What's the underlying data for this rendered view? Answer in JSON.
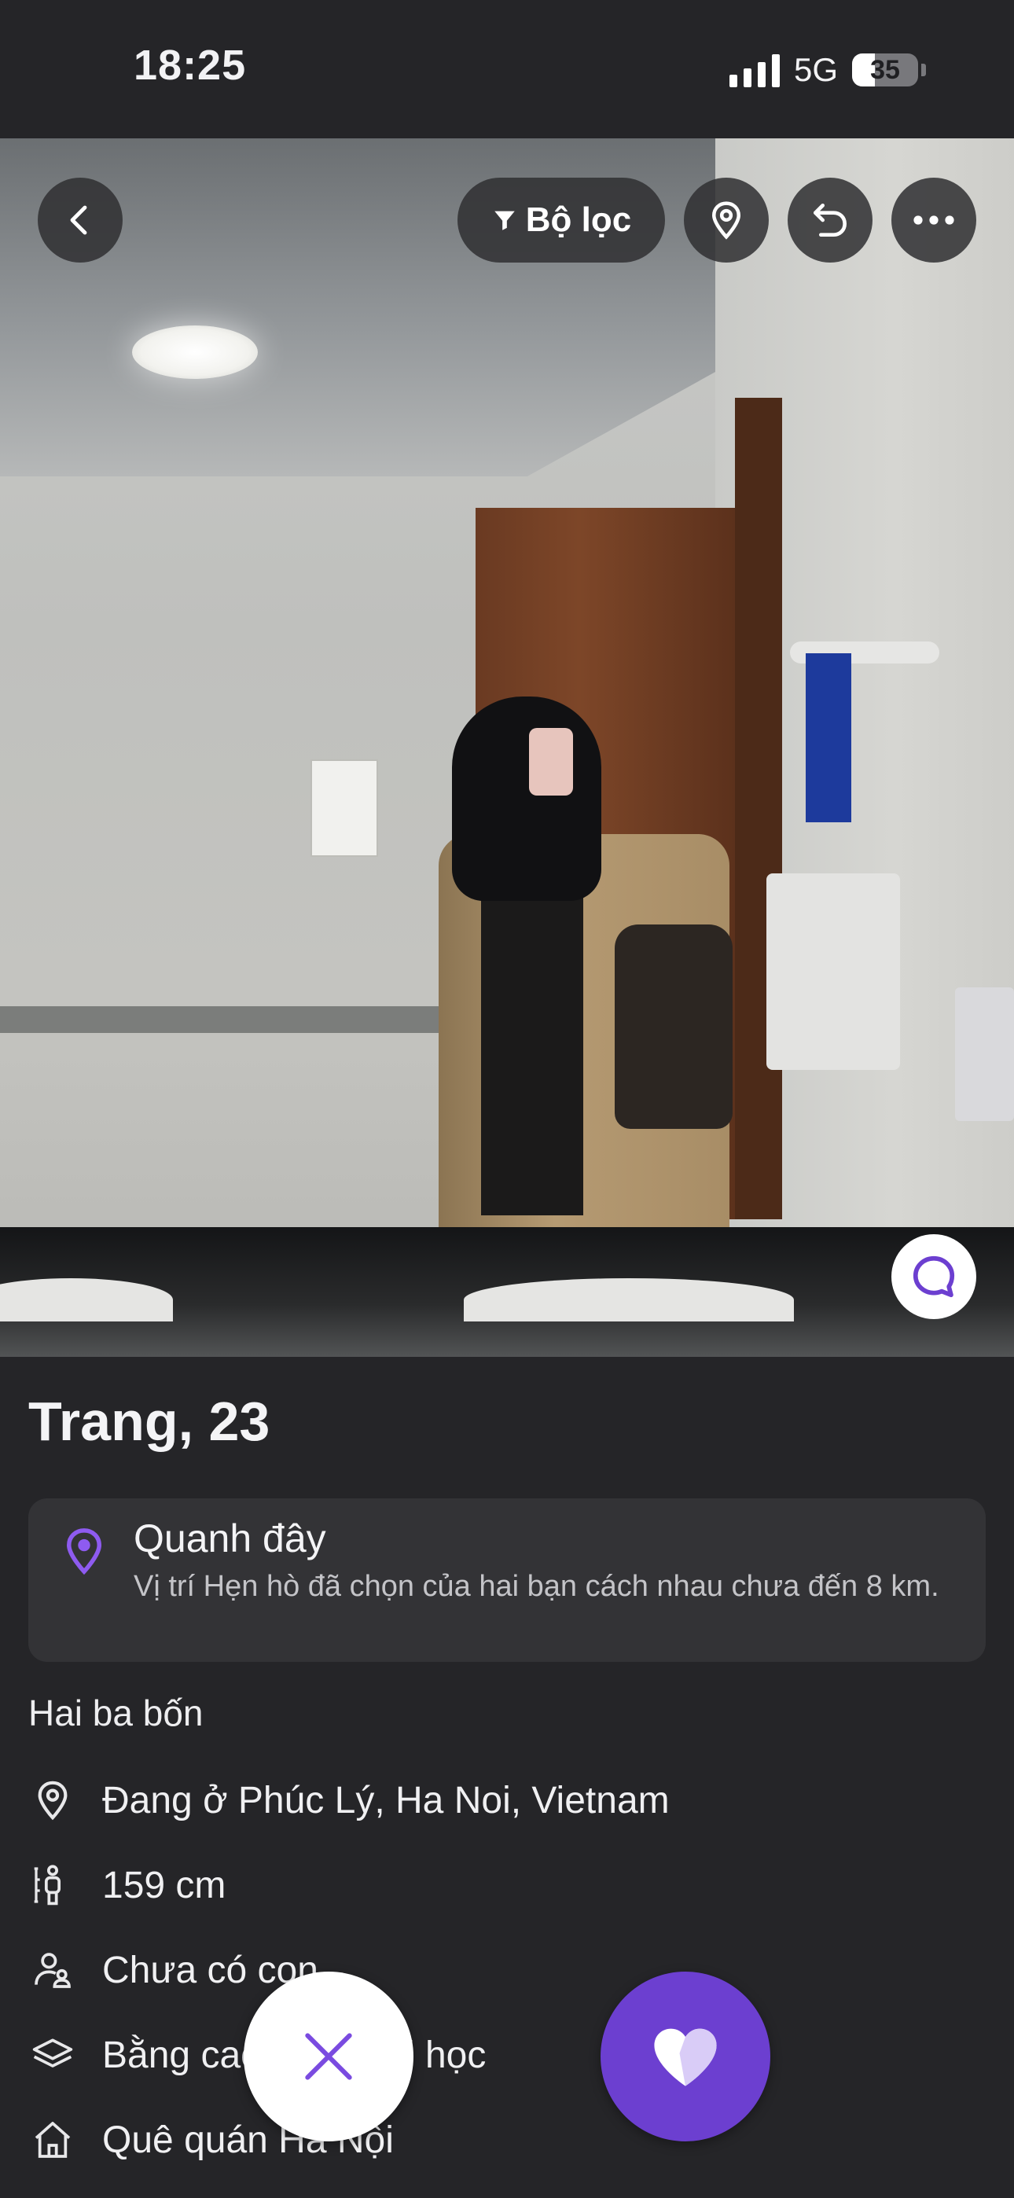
{
  "status_bar": {
    "time": "18:25",
    "network": "5G",
    "battery_percent": 35,
    "battery_label": "35"
  },
  "toolbar": {
    "filter_label": "Bộ lọc"
  },
  "profile": {
    "name_age": "Trang, 23",
    "nearby": {
      "title": "Quanh đây",
      "subtitle": "Vị trí Hẹn hò đã chọn của hai bạn cách nhau chưa đến 8 km."
    },
    "tagline": "Hai ba bốn",
    "details": [
      {
        "icon": "location-pin-icon",
        "text": "Đang ở Phúc Lý, Ha Noi, Vietnam"
      },
      {
        "icon": "height-icon",
        "text": "159 cm"
      },
      {
        "icon": "children-icon",
        "text": "Chưa có con"
      },
      {
        "icon": "education-icon",
        "text": "Bằng cao học / đại học"
      },
      {
        "icon": "hometown-icon",
        "text": "Quê quán Hà Nội"
      }
    ]
  },
  "colors": {
    "accent": "#6c3fd0",
    "background": "#252528",
    "card": "#333336"
  }
}
